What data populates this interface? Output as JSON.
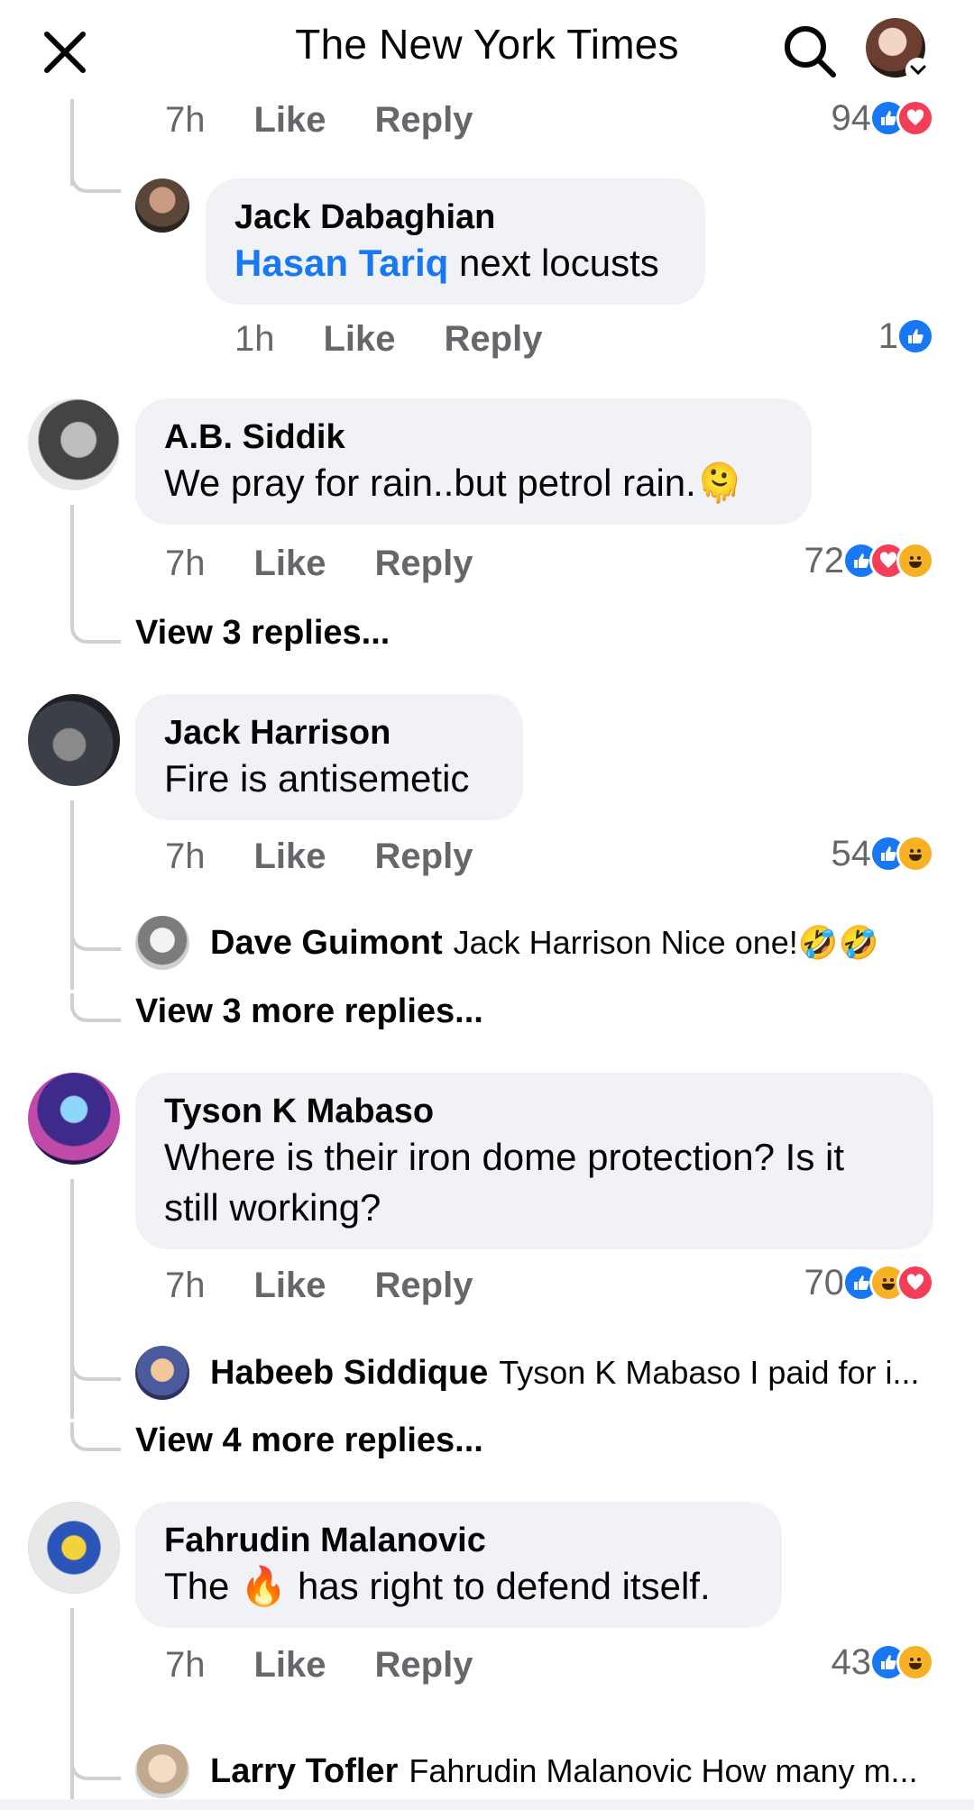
{
  "header": {
    "title": "The New York Times"
  },
  "top_fragment": {
    "time": "7h",
    "like": "Like",
    "reply": "Reply",
    "count": "94",
    "reactions": [
      "like",
      "love"
    ]
  },
  "reply_jack_dabaghian": {
    "name": "Jack Dabaghian",
    "mention": "Hasan Tariq",
    "text": " next locusts",
    "time": "1h",
    "like": "Like",
    "reply": "Reply",
    "count": "1",
    "reactions": [
      "like"
    ]
  },
  "comments": [
    {
      "name": "A.B. Siddik",
      "text": "We pray for rain..but petrol rain.🫠",
      "time": "7h",
      "like": "Like",
      "reply": "Reply",
      "count": "72",
      "view_more": "View 3 replies..."
    },
    {
      "name": "Jack Harrison",
      "text": "Fire is antisemetic",
      "time": "7h",
      "like": "Like",
      "reply": "Reply",
      "count": "54",
      "sub_name": "Dave Guimont",
      "sub_text": "Jack Harrison Nice one!🤣🤣",
      "view_more": "View 3 more replies..."
    },
    {
      "name": "Tyson K Mabaso",
      "text": "Where is their iron dome protection? Is it still working?",
      "time": "7h",
      "like": "Like",
      "reply": "Reply",
      "count": "70",
      "sub_name": "Habeeb Siddique",
      "sub_text": "Tyson K Mabaso I paid for i...",
      "view_more": "View 4 more replies..."
    },
    {
      "name": "Fahrudin Malanovic",
      "text_before": "The ",
      "text_emoji": "🔥",
      "text_after": " has right to defend itself.",
      "time": "7h",
      "like": "Like",
      "reply": "Reply",
      "count": "43",
      "sub_name": "Larry Tofler",
      "sub_text": "Fahrudin Malanovic How many m..."
    }
  ],
  "colors": {
    "like": "#1877f2",
    "love": "#f33e58",
    "haha": "#f7b125",
    "mention": "#1877f2",
    "bubble": "#f0f2f5"
  }
}
